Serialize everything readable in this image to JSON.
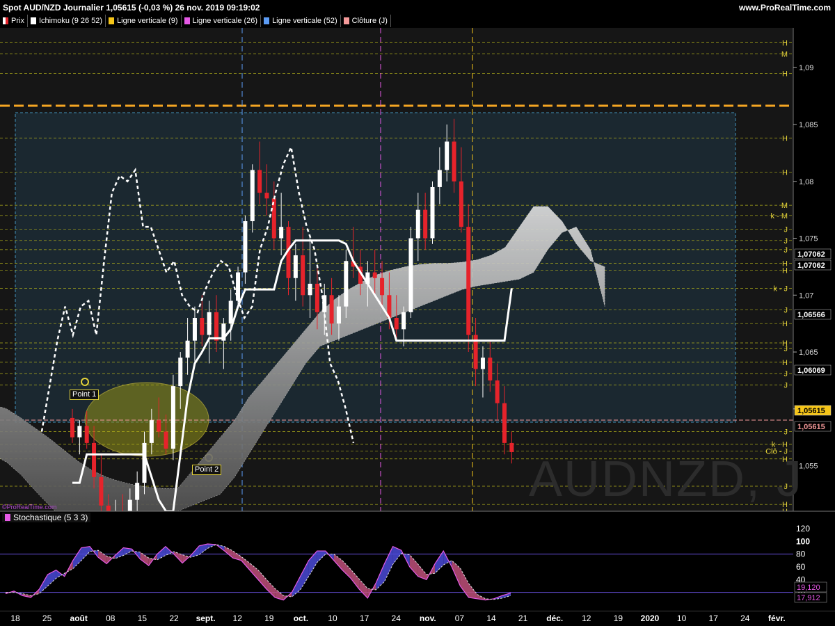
{
  "header": {
    "title": "Spot AUD/NZD Journalier 1,05615 (-0,03 %) 26 nov. 2019 09:19:02",
    "brand": "www.ProRealTime.com"
  },
  "legend": [
    {
      "label": "Prix",
      "color": "#ffffff"
    },
    {
      "label": "Ichimoku (9 26 52)",
      "color": "#ffffff"
    },
    {
      "label": "Ligne verticale (9)",
      "color": "#f5c518"
    },
    {
      "label": "Ligne verticale (26)",
      "color": "#e659e6"
    },
    {
      "label": "Ligne verticale (52)",
      "color": "#5c9cf5"
    },
    {
      "label": "Clôture (J)",
      "color": "#f59a9a"
    }
  ],
  "watermark": "AUDNZD, J",
  "credit": "©ProRealTime.com",
  "annotations": {
    "point1": "Point 1",
    "point2": "Point 2"
  },
  "stoch_legend": "Stochastique (5 3 3)",
  "price_tags": {
    "close": "1,05615",
    "close2": "1,05615",
    "k_j": "1,07062",
    "k_j2": "1,07062",
    "h1": "1,06566",
    "j1": "1,06069"
  },
  "colors": {
    "bull": "#ffffff",
    "bear": "#e6232b",
    "cloud": "#c8c8c8",
    "panel": "#1d2c35",
    "tenkan": "#ffffff"
  },
  "chart_data": {
    "type": "candlestick",
    "title": "Spot AUD/NZD Journalier",
    "ylim": [
      1.051,
      1.0935
    ],
    "yticks": [
      "1,055",
      "1,06",
      "1,065",
      "1,07",
      "1,075",
      "1,08",
      "1,085",
      "1,09"
    ],
    "x_labels": [
      "18",
      "25",
      "août",
      "08",
      "15",
      "22",
      "sept.",
      "12",
      "19",
      "oct.",
      "10",
      "17",
      "24",
      "nov.",
      "07",
      "14",
      "21",
      "déc.",
      "12",
      "19",
      "2020",
      "10",
      "17",
      "24",
      "févr."
    ],
    "level_labels": [
      {
        "label": "H",
        "value": 1.0922
      },
      {
        "label": "M",
        "value": 1.0912
      },
      {
        "label": "H",
        "value": 1.0895
      },
      {
        "label": "H",
        "value": 1.0838
      },
      {
        "label": "H",
        "value": 1.0808
      },
      {
        "label": "M",
        "value": 1.0779
      },
      {
        "label": "k - M",
        "value": 1.077
      },
      {
        "label": "J",
        "value": 1.0758
      },
      {
        "label": "J",
        "value": 1.0748
      },
      {
        "label": "J",
        "value": 1.074
      },
      {
        "label": "H",
        "value": 1.0728
      },
      {
        "label": "H",
        "value": 1.0722
      },
      {
        "label": "k - J",
        "value": 1.0706
      },
      {
        "label": "J",
        "value": 1.0687
      },
      {
        "label": "H",
        "value": 1.0675
      },
      {
        "label": "H",
        "value": 1.0658
      },
      {
        "label": "J",
        "value": 1.0653
      },
      {
        "label": "H",
        "value": 1.0641
      },
      {
        "label": "J",
        "value": 1.0631
      },
      {
        "label": "J",
        "value": 1.0621
      },
      {
        "label": "J",
        "value": 1.058
      },
      {
        "label": "k - H",
        "value": 1.0569
      },
      {
        "label": "Clô - J",
        "value": 1.0563
      },
      {
        "label": "H",
        "value": 1.0556
      },
      {
        "label": "J",
        "value": 1.0532
      },
      {
        "label": "H",
        "value": 1.0516
      },
      {
        "label": "H",
        "value": 1.051
      },
      {
        "label": "J",
        "value": 1.0502
      },
      {
        "label": "J",
        "value": 1.0492
      }
    ],
    "ohlc": [
      [
        1.0592,
        1.06,
        1.057,
        1.0575
      ],
      [
        1.0575,
        1.059,
        1.056,
        1.0585
      ],
      [
        1.0585,
        1.0598,
        1.0565,
        1.057
      ],
      [
        1.057,
        1.0585,
        1.053,
        1.054
      ],
      [
        1.054,
        1.056,
        1.05,
        1.0515
      ],
      [
        1.0515,
        1.0525,
        1.0475,
        1.0485
      ],
      [
        1.0485,
        1.052,
        1.047,
        1.051
      ],
      [
        1.051,
        1.0525,
        1.0485,
        1.0495
      ],
      [
        1.0495,
        1.053,
        1.048,
        1.052
      ],
      [
        1.052,
        1.0545,
        1.0505,
        1.0535
      ],
      [
        1.0535,
        1.058,
        1.0525,
        1.057
      ],
      [
        1.057,
        1.06,
        1.056,
        1.059
      ],
      [
        1.059,
        1.061,
        1.0575,
        1.058
      ],
      [
        1.058,
        1.0595,
        1.056,
        1.0565
      ],
      [
        1.0565,
        1.063,
        1.0555,
        1.062
      ],
      [
        1.062,
        1.065,
        1.06,
        1.0645
      ],
      [
        1.0645,
        1.068,
        1.063,
        1.066
      ],
      [
        1.066,
        1.069,
        1.064,
        1.068
      ],
      [
        1.068,
        1.07,
        1.0655,
        1.0665
      ],
      [
        1.0665,
        1.0695,
        1.064,
        1.0685
      ],
      [
        1.0685,
        1.07,
        1.065,
        1.066
      ],
      [
        1.066,
        1.068,
        1.0635,
        1.0675
      ],
      [
        1.0675,
        1.0705,
        1.066,
        1.0695
      ],
      [
        1.0695,
        1.0725,
        1.069,
        1.072
      ],
      [
        1.072,
        1.077,
        1.071,
        1.0765
      ],
      [
        1.0765,
        1.0815,
        1.0755,
        1.081
      ],
      [
        1.081,
        1.0835,
        1.078,
        1.079
      ],
      [
        1.079,
        1.0815,
        1.077,
        1.0785
      ],
      [
        1.0785,
        1.08,
        1.074,
        1.075
      ],
      [
        1.075,
        1.079,
        1.0735,
        1.076
      ],
      [
        1.076,
        1.0765,
        1.07,
        1.0715
      ],
      [
        1.0715,
        1.0745,
        1.0695,
        1.0735
      ],
      [
        1.0735,
        1.076,
        1.069,
        1.07
      ],
      [
        1.07,
        1.075,
        1.068,
        1.071
      ],
      [
        1.071,
        1.0725,
        1.067,
        1.0685
      ],
      [
        1.0685,
        1.071,
        1.0665,
        1.07
      ],
      [
        1.07,
        1.0715,
        1.0665,
        1.0675
      ],
      [
        1.0675,
        1.07,
        1.066,
        1.069
      ],
      [
        1.069,
        1.074,
        1.068,
        1.073
      ],
      [
        1.073,
        1.076,
        1.0715,
        1.0725
      ],
      [
        1.0725,
        1.074,
        1.07,
        1.071
      ],
      [
        1.071,
        1.073,
        1.069,
        1.072
      ],
      [
        1.072,
        1.074,
        1.07,
        1.0715
      ],
      [
        1.0715,
        1.073,
        1.069,
        1.07
      ],
      [
        1.07,
        1.072,
        1.067,
        1.068
      ],
      [
        1.068,
        1.07,
        1.066,
        1.067
      ],
      [
        1.067,
        1.069,
        1.0655,
        1.0685
      ],
      [
        1.0685,
        1.076,
        1.068,
        1.075
      ],
      [
        1.075,
        1.079,
        1.073,
        1.0775
      ],
      [
        1.0775,
        1.079,
        1.074,
        1.075
      ],
      [
        1.075,
        1.08,
        1.0745,
        1.0795
      ],
      [
        1.0795,
        1.083,
        1.078,
        1.081
      ],
      [
        1.081,
        1.085,
        1.08,
        1.0835
      ],
      [
        1.0835,
        1.0855,
        1.079,
        1.08
      ],
      [
        1.08,
        1.083,
        1.0755,
        1.076
      ],
      [
        1.076,
        1.078,
        1.065,
        1.0665
      ],
      [
        1.0665,
        1.068,
        1.062,
        1.0635
      ],
      [
        1.0635,
        1.0655,
        1.061,
        1.0645
      ],
      [
        1.0645,
        1.066,
        1.0615,
        1.0625
      ],
      [
        1.0625,
        1.064,
        1.059,
        1.0605
      ],
      [
        1.0605,
        1.062,
        1.056,
        1.057
      ],
      [
        1.057,
        1.058,
        1.0552,
        1.0562
      ]
    ],
    "cloud_upper": [
      1.0588,
      1.06,
      1.0605,
      1.0604,
      1.06,
      1.0592,
      1.0583,
      1.0574,
      1.0564,
      1.0554,
      1.0546,
      1.054,
      1.0536,
      1.0533,
      1.0531,
      1.053,
      1.053,
      1.0545,
      1.056,
      1.0575,
      1.059,
      1.061,
      1.0625,
      1.064,
      1.0655,
      1.067,
      1.0685,
      1.0696,
      1.0705,
      1.0712,
      1.0718,
      1.0722,
      1.0725,
      1.0727,
      1.0728,
      1.0728,
      1.0729,
      1.0731,
      1.0735,
      1.0742,
      1.076,
      1.0778,
      1.0778,
      1.0765,
      1.0745,
      1.073,
      1.0725
    ],
    "cloud_lower": [
      1.056,
      1.056,
      1.0562,
      1.056,
      1.0553,
      1.0542,
      1.0528,
      1.0515,
      1.0503,
      1.0495,
      1.0492,
      1.0492,
      1.0494,
      1.0497,
      1.05,
      1.0505,
      1.051,
      1.0515,
      1.052,
      1.0525,
      1.054,
      1.056,
      1.058,
      1.06,
      1.062,
      1.064,
      1.0655,
      1.066,
      1.0665,
      1.067,
      1.0675,
      1.068,
      1.0685,
      1.069,
      1.0695,
      1.07,
      1.0705,
      1.0708,
      1.071,
      1.0712,
      1.0714,
      1.072,
      1.074,
      1.0755,
      1.076,
      1.074,
      1.069
    ],
    "kijun": [
      1.0535,
      1.0535,
      1.056,
      1.056,
      1.056,
      1.056,
      1.056,
      1.056,
      1.056,
      1.056,
      1.056,
      1.054,
      1.052,
      1.051,
      1.051,
      1.056,
      1.061,
      1.064,
      1.065,
      1.0662,
      1.0662,
      1.0662,
      1.067,
      1.069,
      1.0705,
      1.0705,
      1.0705,
      1.0705,
      1.0705,
      1.073,
      1.074,
      1.0748,
      1.0748,
      1.0748,
      1.0748,
      1.0748,
      1.0748,
      1.0748,
      1.0745,
      1.073,
      1.072,
      1.071,
      1.07,
      1.069,
      1.068,
      1.066,
      1.066,
      1.066,
      1.066,
      1.066,
      1.066,
      1.066,
      1.066,
      1.066,
      1.066,
      1.066,
      1.066,
      1.066,
      1.066,
      1.066,
      1.066,
      1.0706
    ],
    "chikou": [
      1.058,
      1.062,
      1.066,
      1.069,
      1.0665,
      1.069,
      1.0695,
      1.0665,
      1.073,
      1.079,
      1.0805,
      1.08,
      1.081,
      1.076,
      1.076,
      1.074,
      1.072,
      1.073,
      1.07,
      1.069,
      1.0685,
      1.0705,
      1.072,
      1.073,
      1.0725,
      1.07,
      1.068,
      1.069,
      1.074,
      1.076,
      1.079,
      1.0815,
      1.083,
      1.079,
      1.076,
      1.074,
      1.07,
      1.064,
      1.0625,
      1.06,
      1.057
    ]
  },
  "stochastic": {
    "ylim": [
      0,
      120
    ],
    "ticks": [
      "120",
      "100",
      "80",
      "60",
      "40",
      "20"
    ],
    "tags": [
      "19,120",
      "17,912"
    ],
    "k": [
      18,
      22,
      15,
      12,
      25,
      48,
      55,
      45,
      70,
      90,
      92,
      75,
      65,
      78,
      90,
      88,
      72,
      62,
      80,
      92,
      80,
      66,
      78,
      93,
      96,
      95,
      85,
      74,
      70,
      55,
      40,
      25,
      12,
      8,
      20,
      45,
      70,
      85,
      85,
      70,
      55,
      42,
      25,
      11,
      35,
      65,
      92,
      86,
      60,
      45,
      40,
      65,
      85,
      60,
      30,
      12,
      10,
      8,
      10,
      15,
      19
    ],
    "d": [
      20,
      20,
      18,
      15,
      18,
      30,
      42,
      50,
      57,
      70,
      84,
      86,
      77,
      73,
      78,
      85,
      83,
      74,
      71,
      78,
      84,
      79,
      75,
      79,
      89,
      95,
      92,
      85,
      76,
      66,
      55,
      40,
      26,
      15,
      13,
      24,
      45,
      67,
      80,
      80,
      70,
      56,
      41,
      26,
      24,
      37,
      64,
      81,
      79,
      64,
      48,
      50,
      63,
      70,
      58,
      34,
      17,
      10,
      9,
      11,
      15
    ]
  }
}
